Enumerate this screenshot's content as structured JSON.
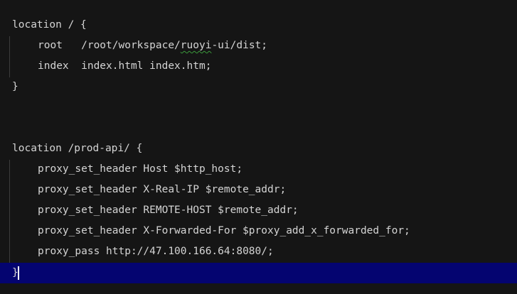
{
  "editor": {
    "block1": {
      "open": "location / {",
      "root": {
        "prefix": "root   /root/workspace/",
        "squiggle": "ruoyi",
        "suffix": "-ui/dist;"
      },
      "index": "index  index.html index.htm;",
      "close": "}"
    },
    "block2": {
      "open": "location /prod-api/ {",
      "lines": [
        "proxy_set_header Host $http_host;",
        "proxy_set_header X-Real-IP $remote_addr;",
        "proxy_set_header REMOTE-HOST $remote_addr;",
        "proxy_set_header X-Forwarded-For $proxy_add_x_forwarded_for;",
        "proxy_pass http://47.100.166.64:8080/;"
      ],
      "close": "}"
    }
  },
  "colors": {
    "background": "#151515",
    "text": "#d4d4d4",
    "current_line": "#040470",
    "indent_guide": "#3c3c3c",
    "squiggle": "#3a9a3a"
  }
}
